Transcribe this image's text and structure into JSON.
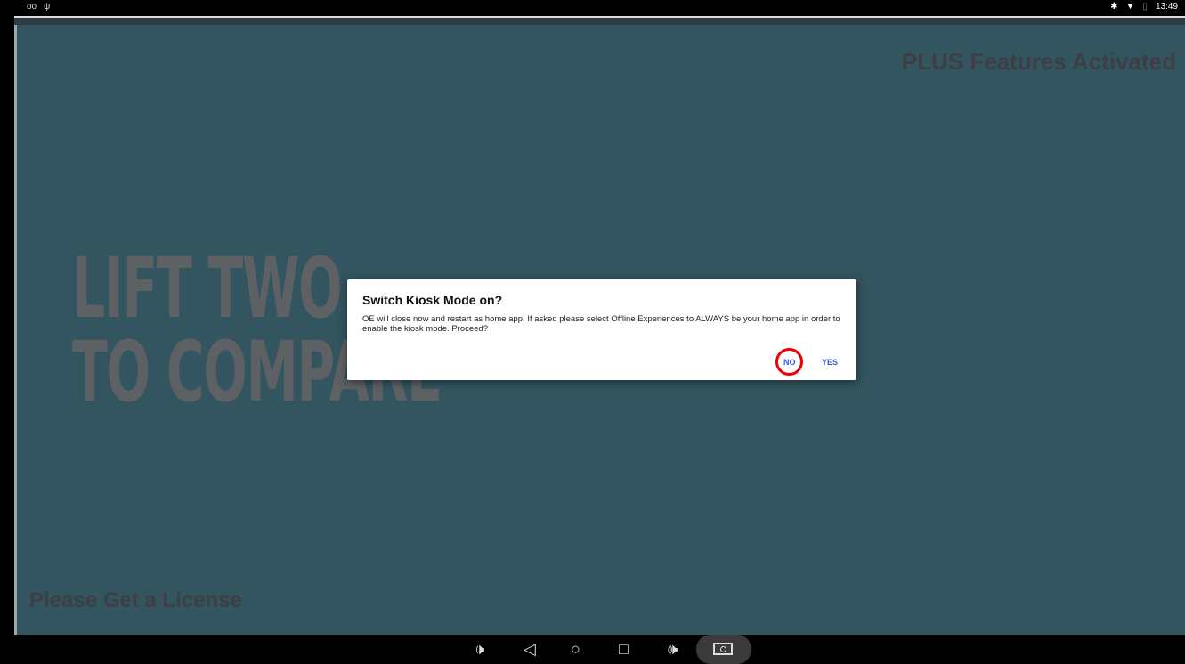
{
  "status_bar": {
    "left_icons": [
      "oo",
      "ψ"
    ],
    "time": "13:49",
    "right_icons": [
      "bluetooth-icon",
      "wifi-icon",
      "battery-icon"
    ]
  },
  "app": {
    "plus_banner": "PLUS Features Activated",
    "headline_line1": "LIFT TWO",
    "headline_line2": "TO COMPARE",
    "license_text": "Please Get a License"
  },
  "dialog": {
    "title": "Switch Kiosk Mode on?",
    "message": "OE will close now and restart as home app. If asked please select Offline Experiences to ALWAYS be your home app in order to enable the kiosk mode. Proceed?",
    "no_label": "NO",
    "yes_label": "YES"
  },
  "nav_bar": {
    "icons": [
      "volume-down-icon",
      "back-icon",
      "home-icon",
      "recents-icon",
      "volume-up-icon",
      "screenshot-icon"
    ]
  }
}
